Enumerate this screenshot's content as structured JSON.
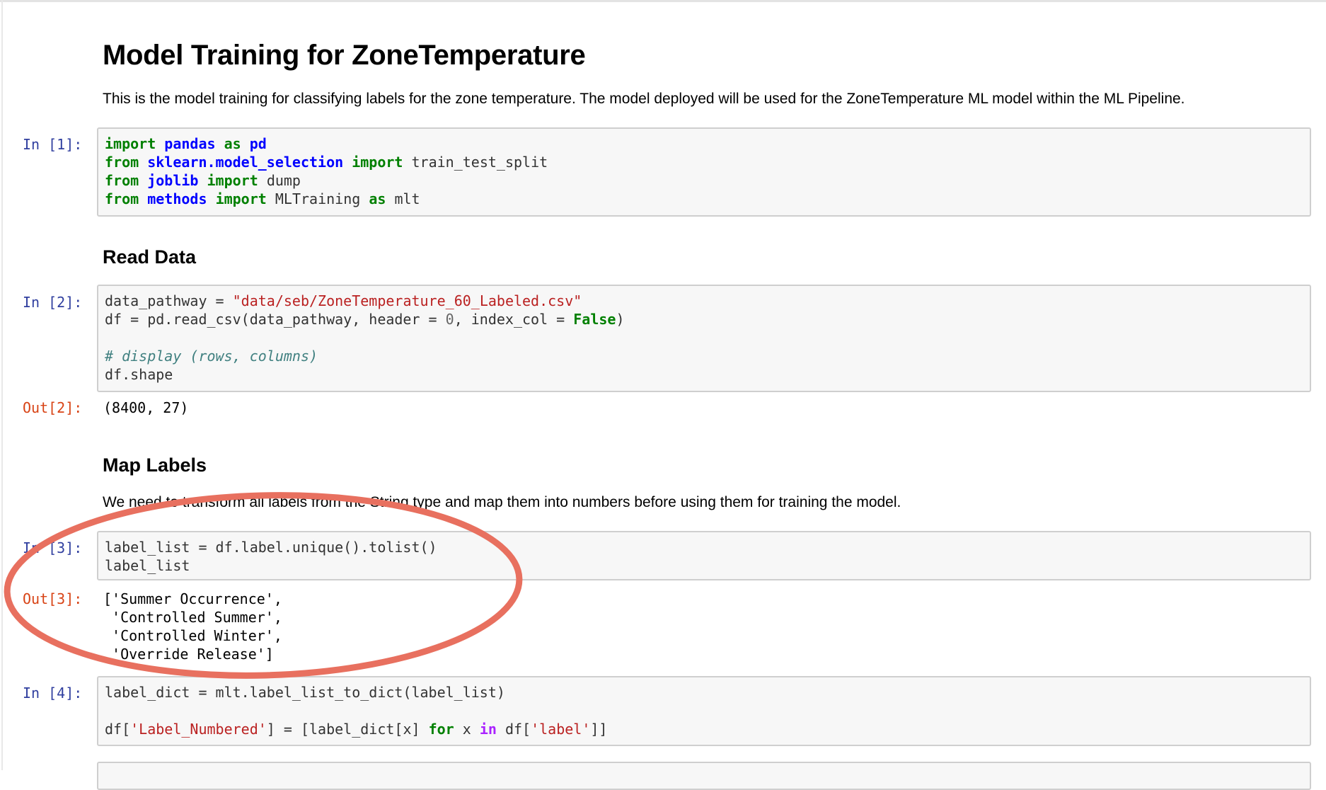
{
  "notebook": {
    "title": "Model Training for ZoneTemperature",
    "intro": "This is the model training for classifying labels for the zone temperature. The model deployed will be used for the ZoneTemperature ML model within the ML Pipeline.",
    "sections": {
      "read_data": "Read Data",
      "map_labels": "Map Labels",
      "map_labels_text": "We need to transform all labels from the String type and map them into numbers before using them for training the model."
    },
    "cells": [
      {
        "in_prompt": "In [1]:"
      },
      {
        "in_prompt": "In [2]:",
        "out_prompt": "Out[2]:",
        "output": "(8400, 27)"
      },
      {
        "in_prompt": "In [3]:",
        "out_prompt": "Out[3]:",
        "output": "['Summer Occurrence',\n 'Controlled Summer',\n 'Controlled Winter',\n 'Override Release']"
      },
      {
        "in_prompt": "In [4]:"
      }
    ]
  },
  "code": {
    "c1": {
      "l1": [
        "import",
        "pandas",
        "as",
        "pd"
      ],
      "l2": [
        "from",
        "sklearn.model_selection",
        "import",
        "train_test_split"
      ],
      "l3": [
        "from",
        "joblib",
        "import",
        "dump"
      ],
      "l4": [
        "from",
        "methods",
        "import",
        "MLTraining",
        "as",
        "mlt"
      ]
    },
    "c2": {
      "l1a": "data_pathway = ",
      "l1s": "\"data/seb/ZoneTemperature_60_Labeled.csv\"",
      "l2a": "df = pd.read_csv(data_pathway, header = ",
      "l2n": "0",
      "l2b": ", index_col = ",
      "l2k": "False",
      "l2c": ")",
      "l3": "# display (rows, columns)",
      "l4": "df.shape"
    },
    "c3": {
      "l1": "label_list = df.label.unique().tolist()",
      "l2": "label_list"
    },
    "c4": {
      "l1": "label_dict = mlt.label_list_to_dict(label_list)",
      "l2a": "df[",
      "l2s1": "'Label_Numbered'",
      "l2b": "] = [label_dict[x] ",
      "l2k": "for",
      "l2c": " x ",
      "l2o": "in",
      "l2d": " df[",
      "l2s2": "'label'",
      "l2e": "]]"
    }
  },
  "annotation": {
    "color": "#e8705f"
  }
}
